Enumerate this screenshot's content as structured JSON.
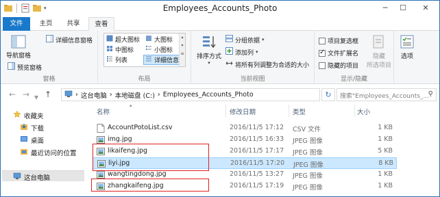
{
  "window": {
    "title": "Employees_Accounts_Photo",
    "controls": {
      "minimize": "─",
      "maximize": "☐",
      "close": "✕"
    }
  },
  "tabs": [
    {
      "label": "文件",
      "active": false
    },
    {
      "label": "主页",
      "active": false
    },
    {
      "label": "共享",
      "active": false
    },
    {
      "label": "查看",
      "active": true
    }
  ],
  "ribbon": {
    "panes": {
      "group_label": "窗格",
      "nav_pane": "导航窗格",
      "preview_pane": "预览窗格",
      "details_pane": "详细信息窗格"
    },
    "layout": {
      "group_label": "布局",
      "items": [
        {
          "label": "超大图标"
        },
        {
          "label": "大图标"
        },
        {
          "label": "中图标"
        },
        {
          "label": "小图标"
        },
        {
          "label": "列表"
        },
        {
          "label": "详细信息",
          "selected": true
        }
      ]
    },
    "current_view": {
      "group_label": "当前视图",
      "sort_by": "排序方式",
      "group_by": "分组依据",
      "add_column": "添加列",
      "fit_columns": "将所有列调整为合适的大小"
    },
    "show_hide": {
      "group_label": "显示/隐藏",
      "item_checkboxes": {
        "label": "项目复选框",
        "checked": false
      },
      "file_extensions": {
        "label": "文件扩展名",
        "checked": true
      },
      "hidden_items": {
        "label": "隐藏的项目",
        "checked": false
      },
      "hide_button": "隐藏",
      "hide_sub": "所选项目"
    },
    "options": "选项"
  },
  "address": {
    "back": "←",
    "forward": "→",
    "up": "↑",
    "crumbs": [
      "这台电脑",
      "本地磁盘 (C:)",
      "Employees_Accounts_Photo"
    ],
    "search_placeholder": "搜索\"Employees_Accounts_...",
    "refresh": "↻"
  },
  "nav_pane": {
    "favorites": "收藏夹",
    "items": [
      "下载",
      "桌面",
      "最近访问的位置"
    ],
    "this_pc": "这台电脑"
  },
  "columns": {
    "name": "名称",
    "date": "修改日期",
    "type": "类型",
    "size": "大小"
  },
  "files": [
    {
      "name": "AccountPotoList.csv",
      "date": "2016/11/5 17:12",
      "type": "CSV 文件",
      "size": "1 KB",
      "kind": "csv",
      "selected": false,
      "highlighted": false
    },
    {
      "name": "img.jpg",
      "date": "2016/11/5 16:33",
      "type": "JPEG 图像",
      "size": "1 KB",
      "kind": "jpg",
      "selected": false,
      "highlighted": false
    },
    {
      "name": "likaifeng.jpg",
      "date": "2016/11/5 17:17",
      "type": "JPEG 图像",
      "size": "5 KB",
      "kind": "jpg",
      "selected": false,
      "highlighted": true
    },
    {
      "name": "liyi.jpg",
      "date": "2016/11/5 17:20",
      "type": "JPEG 图像",
      "size": "8 KB",
      "kind": "jpg",
      "selected": true,
      "highlighted": true
    },
    {
      "name": "wangtingdong.jpg",
      "date": "2016/11/5 13:27",
      "type": "JPEG 图像",
      "size": "1 KB",
      "kind": "jpg",
      "selected": false,
      "highlighted": false
    },
    {
      "name": "zhangkaifeng.jpg",
      "date": "2016/11/5 17:19",
      "type": "JPEG 图像",
      "size": "1 KB",
      "kind": "jpg",
      "selected": false,
      "highlighted": true
    }
  ],
  "colors": {
    "accent": "#1979ca",
    "selection": "#cce8ff",
    "highlight_box": "#e02020",
    "folder": "#e8b84a"
  }
}
